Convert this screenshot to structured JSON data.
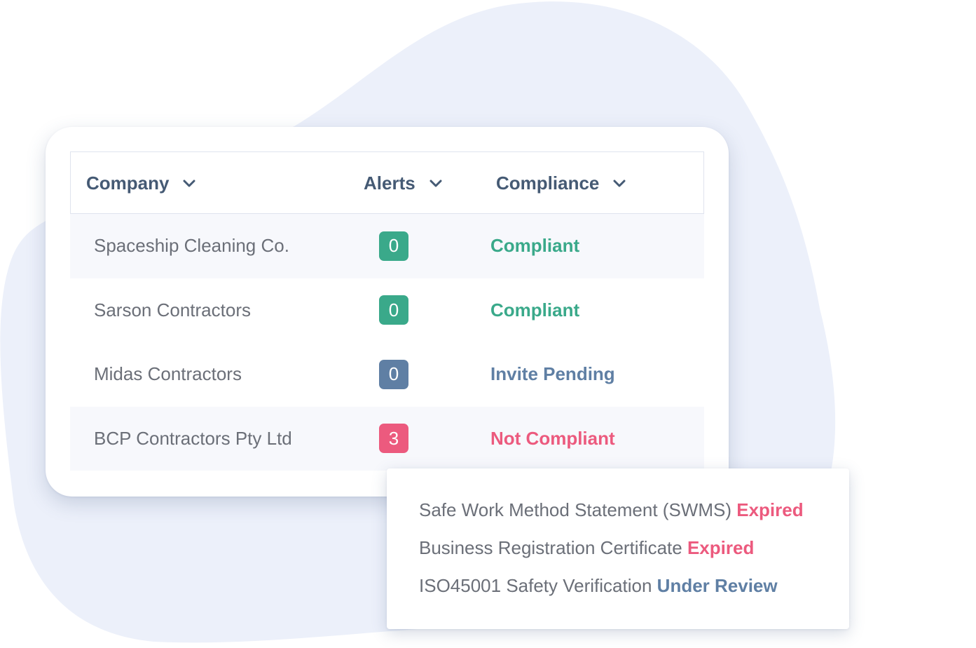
{
  "colors": {
    "blob": "#ecf0fa",
    "header_text": "#455a74",
    "body_text": "#6b6f78",
    "green": "#3aa98a",
    "blue": "#5f7fa4",
    "red": "#ec5a7e",
    "row_shade": "#f7f8fc"
  },
  "table": {
    "columns": [
      {
        "label": "Company",
        "icon": "chevron-down-icon"
      },
      {
        "label": "Alerts",
        "icon": "chevron-down-icon"
      },
      {
        "label": "Compliance",
        "icon": "chevron-down-icon"
      }
    ],
    "rows": [
      {
        "company": "Spaceship Cleaning Co.",
        "alerts": "0",
        "alert_color": "#3aa98a",
        "status": "Compliant",
        "status_color": "#3aa98a"
      },
      {
        "company": "Sarson Contractors",
        "alerts": "0",
        "alert_color": "#3aa98a",
        "status": "Compliant",
        "status_color": "#3aa98a"
      },
      {
        "company": "Midas Contractors",
        "alerts": "0",
        "alert_color": "#5f7fa4",
        "status": "Invite Pending",
        "status_color": "#5f7fa4"
      },
      {
        "company": "BCP Contractors Pty Ltd",
        "alerts": "3",
        "alert_color": "#ec5a7e",
        "status": "Not Compliant",
        "status_color": "#ec5a7e"
      }
    ]
  },
  "popover": {
    "items": [
      {
        "document": "Safe Work Method Statement (SWMS)",
        "status": "Expired",
        "status_color": "#ec5a7e"
      },
      {
        "document": "Business Registration Certificate",
        "status": "Expired",
        "status_color": "#ec5a7e"
      },
      {
        "document": "ISO45001 Safety Verification",
        "status": "Under Review",
        "status_color": "#5f7fa4"
      }
    ]
  }
}
